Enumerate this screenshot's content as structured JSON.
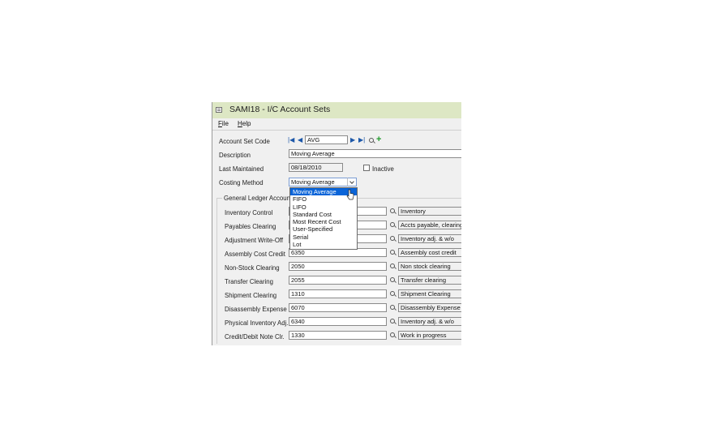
{
  "window": {
    "title": "SAMI18 - I/C Account Sets"
  },
  "menu": [
    {
      "label": "File"
    },
    {
      "label": "Help"
    }
  ],
  "header_fields": {
    "account_set_code": {
      "label": "Account Set Code",
      "value": "AVG"
    },
    "description": {
      "label": "Description",
      "value": "Moving Average"
    },
    "last_maintained": {
      "label": "Last Maintained",
      "value": "08/18/2010"
    },
    "inactive_label": "Inactive",
    "costing_method": {
      "label": "Costing Method",
      "value": "Moving Average"
    }
  },
  "costing_options": [
    "Moving Average",
    "FIFO",
    "LIFO",
    "Standard Cost",
    "Most Recent Cost",
    "User-Specified",
    "Serial",
    "Lot"
  ],
  "gl_group_title": "General Ledger Accounts",
  "gl_accounts": [
    {
      "label": "Inventory Control",
      "account": "",
      "desc": "Inventory"
    },
    {
      "label": "Payables Clearing",
      "account": "",
      "desc": "Accts payable, clearing"
    },
    {
      "label": "Adjustment Write-Off",
      "account": "",
      "desc": "Inventory adj. & w/o"
    },
    {
      "label": "Assembly Cost Credit",
      "account": "6350",
      "desc": "Assembly cost credit"
    },
    {
      "label": "Non-Stock Clearing",
      "account": "2050",
      "desc": "Non stock clearing"
    },
    {
      "label": "Transfer Clearing",
      "account": "2055",
      "desc": "Transfer clearing"
    },
    {
      "label": "Shipment Clearing",
      "account": "1310",
      "desc": "Shipment Clearing"
    },
    {
      "label": "Disassembly Expense",
      "account": "6070",
      "desc": "Disassembly Expense"
    },
    {
      "label": "Physical Inventory Adj.",
      "account": "6340",
      "desc": "Inventory adj. & w/o"
    },
    {
      "label": "Credit/Debit Note Clr.",
      "account": "1330",
      "desc": "Work in progress"
    }
  ]
}
